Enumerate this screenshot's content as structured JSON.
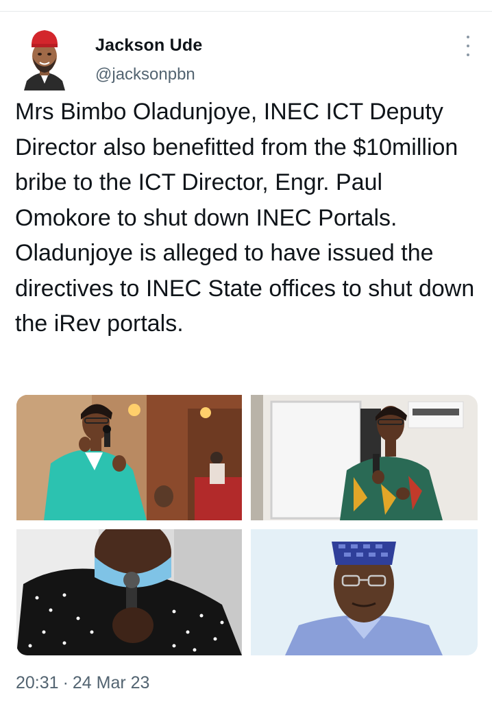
{
  "tweet": {
    "author_name": "Jackson Ude",
    "author_handle": "@jacksonpbn",
    "text": "Mrs Bimbo Oladunjoye, INEC ICT Deputy Director also benefitted from the $10million bribe to the ICT Director, Engr. Paul Omokore to shut down INEC Portals. Oladunjoye is alleged to have issued the directives to INEC State offices to shut down the iRev portals.",
    "time": "20:31",
    "separator": "·",
    "date": "24 Mar 23"
  },
  "icons": {
    "more": "more-vertical-icon"
  },
  "colors": {
    "text_primary": "#0f1419",
    "text_secondary": "#536471"
  }
}
